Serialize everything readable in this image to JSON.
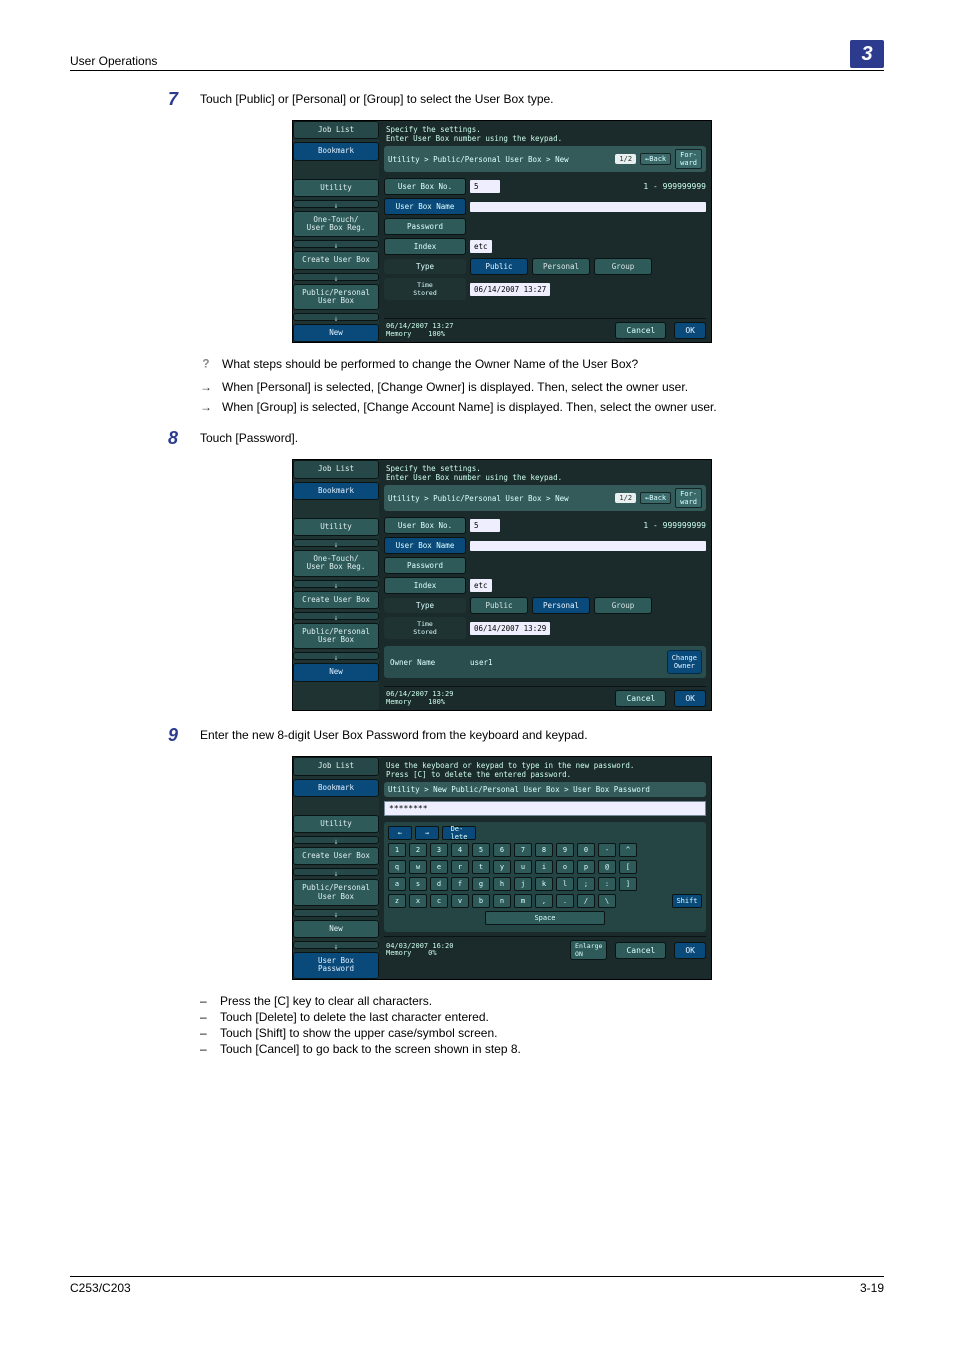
{
  "header": {
    "section": "User Operations",
    "chapter": "3"
  },
  "footer": {
    "left": "C253/C203",
    "right": "3-19"
  },
  "steps": {
    "s7": {
      "num": "7",
      "text": "Touch [Public] or [Personal] or [Group] to select the User Box type."
    },
    "s8": {
      "num": "8",
      "text": "Touch [Password]."
    },
    "s9": {
      "num": "9",
      "text": "Enter the new 8-digit User Box Password from the keyboard and keypad."
    }
  },
  "qa": {
    "q": "What steps should be performed to change the Owner Name of the User Box?",
    "a1": "When [Personal] is selected, [Change Owner] is displayed. Then, select the owner user.",
    "a2": "When [Group] is selected, [Change Account Name] is displayed. Then, select the owner user."
  },
  "notes": {
    "n1": "Press the [C] key to clear all characters.",
    "n2": "Touch [Delete] to delete the last character entered.",
    "n3": "Touch [Shift] to show the upper case/symbol screen.",
    "n4": "Touch [Cancel] to go back to the screen shown in step 8."
  },
  "shot_common": {
    "job_list": "Job List",
    "bookmark": "Bookmark",
    "utility": "Utility",
    "one_touch": "One-Touch/\nUser Box Reg.",
    "create_ub": "Create User Box",
    "pub_pers": "Public/Personal\nUser Box",
    "new": "New",
    "ub_pass": "User Box\nPassword",
    "cancel": "Cancel",
    "ok": "OK",
    "back": "←Back",
    "forward": "For-\nward",
    "page": "1/2",
    "memory": "Memory",
    "mempct": "100%"
  },
  "shot1": {
    "instr": "Specify the settings.\nEnter User Box number using the keypad.",
    "crumb": "Utility > Public/Personal User Box > New",
    "ubno_label": "User Box No.",
    "ubno_val": "5",
    "ubno_range": "1 - 999999999",
    "ubname_label": "User Box Name",
    "password_label": "Password",
    "index_label": "Index",
    "index_val": "etc",
    "type_label": "Type",
    "type_public": "Public",
    "type_personal": "Personal",
    "type_group": "Group",
    "time_label": "Time\nStored",
    "time_val": "06/14/2007  13:27",
    "status_time": "06/14/2007   13:27"
  },
  "shot2": {
    "instr": "Specify the settings.\nEnter User Box number using the keypad.",
    "crumb": "Utility > Public/Personal User Box > New",
    "ubno_label": "User Box No.",
    "ubno_val": "5",
    "ubno_range": "1 - 999999999",
    "ubname_label": "User Box Name",
    "password_label": "Password",
    "index_label": "Index",
    "index_val": "etc",
    "type_label": "Type",
    "type_public": "Public",
    "type_personal": "Personal",
    "type_group": "Group",
    "time_label": "Time\nStored",
    "time_val": "06/14/2007  13:29",
    "owner_label": "Owner Name",
    "owner_val": "user1",
    "change_owner": "Change\nOwner",
    "status_time": "06/14/2007   13:29"
  },
  "shot3": {
    "instr": "Use the keyboard or keypad to type in the new password.\nPress [C] to delete the entered password.",
    "crumb": "Utility > New Public/Personal User Box > User Box Password",
    "pwmask": "********",
    "delete": "De-\nlete",
    "space": "Space",
    "shift": "Shift",
    "enlarge": "Enlarge\nON",
    "status_time": "04/03/2007   16:20",
    "mempct": "0%",
    "row_num": [
      "1",
      "2",
      "3",
      "4",
      "5",
      "6",
      "7",
      "8",
      "9",
      "0",
      "-",
      "^"
    ],
    "row_q": [
      "q",
      "w",
      "e",
      "r",
      "t",
      "y",
      "u",
      "i",
      "o",
      "p",
      "@",
      "["
    ],
    "row_a": [
      "a",
      "s",
      "d",
      "f",
      "g",
      "h",
      "j",
      "k",
      "l",
      ";",
      ":",
      "]"
    ],
    "row_z": [
      "z",
      "x",
      "c",
      "v",
      "b",
      "n",
      "m",
      ",",
      ".",
      "/",
      "\\"
    ]
  }
}
